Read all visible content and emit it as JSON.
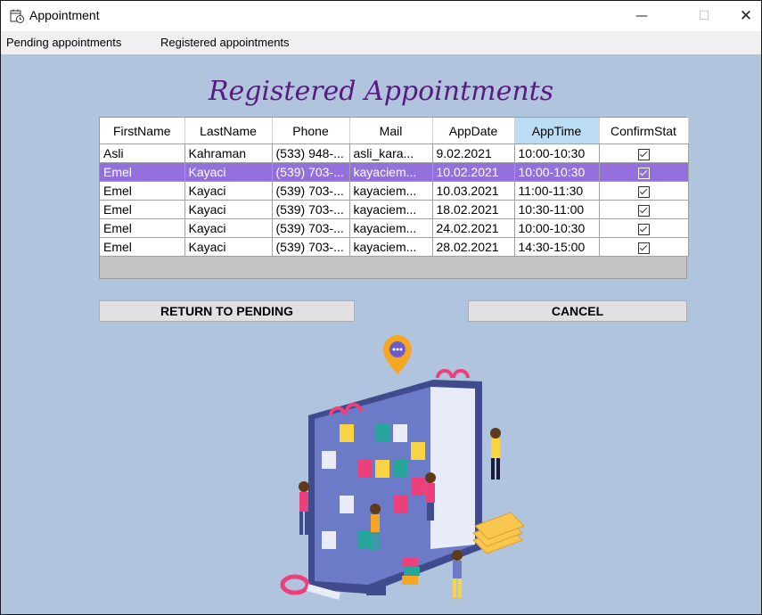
{
  "window": {
    "title": "Appointment",
    "minimize_glyph": "—",
    "maximize_glyph": "☐",
    "close_glyph": "✕",
    "icon": "calendar-clock-icon"
  },
  "menu": {
    "items": [
      "Pending appointments",
      "Registered appointments"
    ]
  },
  "heading": "Registered Appointments",
  "grid": {
    "columns": [
      "FirstName",
      "LastName",
      "Phone",
      "Mail",
      "AppDate",
      "AppTime",
      "ConfirmStat"
    ],
    "sorted_column": "AppTime",
    "rows": [
      {
        "first": "Asli",
        "last": "Kahraman",
        "phone": "(533) 948-...",
        "mail": "asli_kara...",
        "date": "9.02.2021",
        "time": "10:00-10:30",
        "confirmed": true,
        "selected": false
      },
      {
        "first": "Emel",
        "last": "Kayaci",
        "phone": "(539) 703-...",
        "mail": "kayaciem...",
        "date": "10.02.2021",
        "time": "10:00-10:30",
        "confirmed": true,
        "selected": true
      },
      {
        "first": "Emel",
        "last": "Kayaci",
        "phone": "(539) 703-...",
        "mail": "kayaciem...",
        "date": "10.03.2021",
        "time": "11:00-11:30",
        "confirmed": true,
        "selected": false
      },
      {
        "first": "Emel",
        "last": "Kayaci",
        "phone": "(539) 703-...",
        "mail": "kayaciem...",
        "date": "18.02.2021",
        "time": "10:30-11:00",
        "confirmed": true,
        "selected": false
      },
      {
        "first": "Emel",
        "last": "Kayaci",
        "phone": "(539) 703-...",
        "mail": "kayaciem...",
        "date": "24.02.2021",
        "time": "10:00-10:30",
        "confirmed": true,
        "selected": false
      },
      {
        "first": "Emel",
        "last": "Kayaci",
        "phone": "(539) 703-...",
        "mail": "kayaciem...",
        "date": "28.02.2021",
        "time": "14:30-15:00",
        "confirmed": true,
        "selected": false
      }
    ]
  },
  "buttons": {
    "return": "RETURN TO PENDING",
    "cancel": "CANCEL"
  },
  "colors": {
    "background": "#b0c4de",
    "heading": "#5a1a82",
    "selected_row": "#9370db",
    "sorted_header": "#bcdcf4"
  }
}
